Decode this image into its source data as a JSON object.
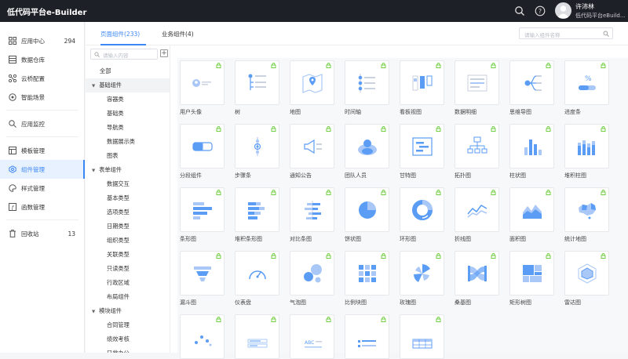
{
  "app": {
    "brand": "低代码平台e-Builder"
  },
  "user": {
    "name": "许沛林",
    "org": "低代码平台eBuild..."
  },
  "icons": {
    "search": "search-icon",
    "help": "help-icon",
    "lock": "lock-icon",
    "plus": "plus-icon"
  },
  "colors": {
    "accent": "#3d87f5",
    "topbar": "#1e2027",
    "lock": "#52c41a"
  },
  "sidebar": {
    "items": [
      {
        "label": "应用中心",
        "count": "294",
        "icon": "grid-icon"
      },
      {
        "label": "数据仓库",
        "icon": "database-icon"
      },
      {
        "label": "云桥配置",
        "icon": "bridge-icon"
      },
      {
        "label": "智能场景",
        "icon": "scene-icon"
      },
      {
        "label": "应用监控",
        "icon": "monitor-icon"
      },
      {
        "label": "模板管理",
        "icon": "template-icon"
      },
      {
        "label": "组件管理",
        "icon": "component-icon"
      },
      {
        "label": "样式管理",
        "icon": "palette-icon"
      },
      {
        "label": "函数管理",
        "icon": "function-icon"
      },
      {
        "label": "回收站",
        "count": "13",
        "icon": "trash-icon"
      }
    ]
  },
  "tabs": [
    {
      "label": "页面组件(233)"
    },
    {
      "label": "业务组件(4)"
    }
  ],
  "search": {
    "placeholder": "请输入组件名称"
  },
  "tree": {
    "placeholder": "请输入内容",
    "nodes": [
      {
        "label": "全部"
      },
      {
        "label": "基础组件",
        "arrow": "▼"
      },
      {
        "label": "容器类"
      },
      {
        "label": "基础类"
      },
      {
        "label": "导航类"
      },
      {
        "label": "数据展示类"
      },
      {
        "label": "图表"
      },
      {
        "label": "表单组件",
        "arrow": "▼"
      },
      {
        "label": "数据交互"
      },
      {
        "label": "基本类型"
      },
      {
        "label": "选项类型"
      },
      {
        "label": "日期类型"
      },
      {
        "label": "组织类型"
      },
      {
        "label": "关联类型"
      },
      {
        "label": "只读类型"
      },
      {
        "label": "行政区域"
      },
      {
        "label": "布局组件"
      },
      {
        "label": "模块组件",
        "arrow": "▼"
      },
      {
        "label": "合同管理"
      },
      {
        "label": "绩效考核"
      },
      {
        "label": "日常办公"
      }
    ]
  },
  "components": [
    {
      "name": "用户头像",
      "icon": "user-avatar-icon"
    },
    {
      "name": "树",
      "icon": "tree-icon"
    },
    {
      "name": "地图",
      "icon": "map-icon"
    },
    {
      "name": "时间轴",
      "icon": "timeline-icon"
    },
    {
      "name": "看板视图",
      "icon": "kanban-icon"
    },
    {
      "name": "数据明细",
      "icon": "data-detail-icon"
    },
    {
      "name": "思维导图",
      "icon": "mind-map-icon"
    },
    {
      "name": "进度条",
      "icon": "progress-icon"
    },
    {
      "name": "分段组件",
      "icon": "segment-icon"
    },
    {
      "name": "步骤条",
      "icon": "steps-icon"
    },
    {
      "name": "通知公告",
      "icon": "notice-icon"
    },
    {
      "name": "团队人员",
      "icon": "team-icon"
    },
    {
      "name": "甘特图",
      "icon": "gantt-icon"
    },
    {
      "name": "拓扑图",
      "icon": "topology-icon"
    },
    {
      "name": "柱状图",
      "icon": "bar-chart-icon"
    },
    {
      "name": "堆积柱图",
      "icon": "stacked-bar-icon"
    },
    {
      "name": "条形图",
      "icon": "hbar-icon"
    },
    {
      "name": "堆积条形图",
      "icon": "stacked-hbar-icon"
    },
    {
      "name": "对比条图",
      "icon": "compare-bar-icon"
    },
    {
      "name": "饼状图",
      "icon": "pie-icon"
    },
    {
      "name": "环形图",
      "icon": "donut-icon"
    },
    {
      "name": "折线图",
      "icon": "line-chart-icon"
    },
    {
      "name": "面积图",
      "icon": "area-chart-icon"
    },
    {
      "name": "统计地图",
      "icon": "stat-map-icon"
    },
    {
      "name": "漏斗图",
      "icon": "funnel-icon"
    },
    {
      "name": "仪表盘",
      "icon": "gauge-icon"
    },
    {
      "name": "气泡图",
      "icon": "bubble-icon"
    },
    {
      "name": "比例块图",
      "icon": "ratio-block-icon"
    },
    {
      "name": "玫瑰图",
      "icon": "rose-icon"
    },
    {
      "name": "桑基图",
      "icon": "sankey-icon"
    },
    {
      "name": "矩形树图",
      "icon": "treemap-icon"
    },
    {
      "name": "雷达图",
      "icon": "radar-icon"
    },
    {
      "name": "",
      "icon": "scatter-icon"
    },
    {
      "name": "",
      "icon": "form-list-icon"
    },
    {
      "name": "",
      "icon": "text-abc-icon"
    },
    {
      "name": "",
      "icon": "list-icon"
    },
    {
      "name": "",
      "icon": "table-icon"
    }
  ]
}
